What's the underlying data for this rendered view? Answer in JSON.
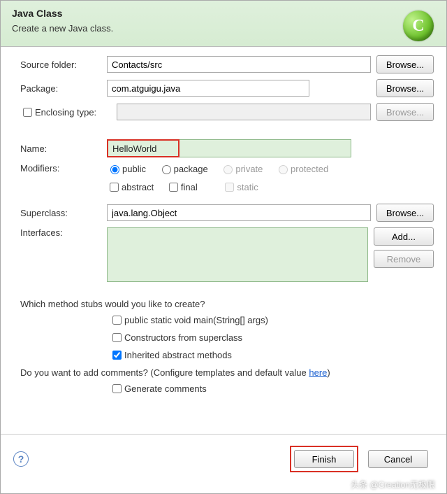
{
  "banner": {
    "title": "Java Class",
    "subtitle": "Create a new Java class.",
    "icon_label": "C"
  },
  "fields": {
    "source_folder_label": "Source folder:",
    "source_folder_value": "Contacts/src",
    "package_label": "Package:",
    "package_value": "com.atguigu.java",
    "enclosing_label": "Enclosing type:",
    "enclosing_value": "",
    "name_label": "Name:",
    "name_value": "HelloWorld",
    "modifiers_label": "Modifiers:",
    "superclass_label": "Superclass:",
    "superclass_value": "java.lang.Object",
    "interfaces_label": "Interfaces:"
  },
  "modifiers": {
    "public": "public",
    "package": "package",
    "private": "private",
    "protected": "protected",
    "abstract": "abstract",
    "final": "final",
    "static": "static"
  },
  "buttons": {
    "browse": "Browse...",
    "add": "Add...",
    "remove": "Remove",
    "finish": "Finish",
    "cancel": "Cancel"
  },
  "stubs": {
    "question": "Which method stubs would you like to create?",
    "main": "public static void main(String[] args)",
    "constructors": "Constructors from superclass",
    "inherited": "Inherited abstract methods"
  },
  "comments": {
    "question_pre": "Do you want to add comments? (Configure templates and default value ",
    "link": "here",
    "question_post": ")",
    "generate": "Generate comments"
  },
  "watermark": "头条 @Creation无极限"
}
